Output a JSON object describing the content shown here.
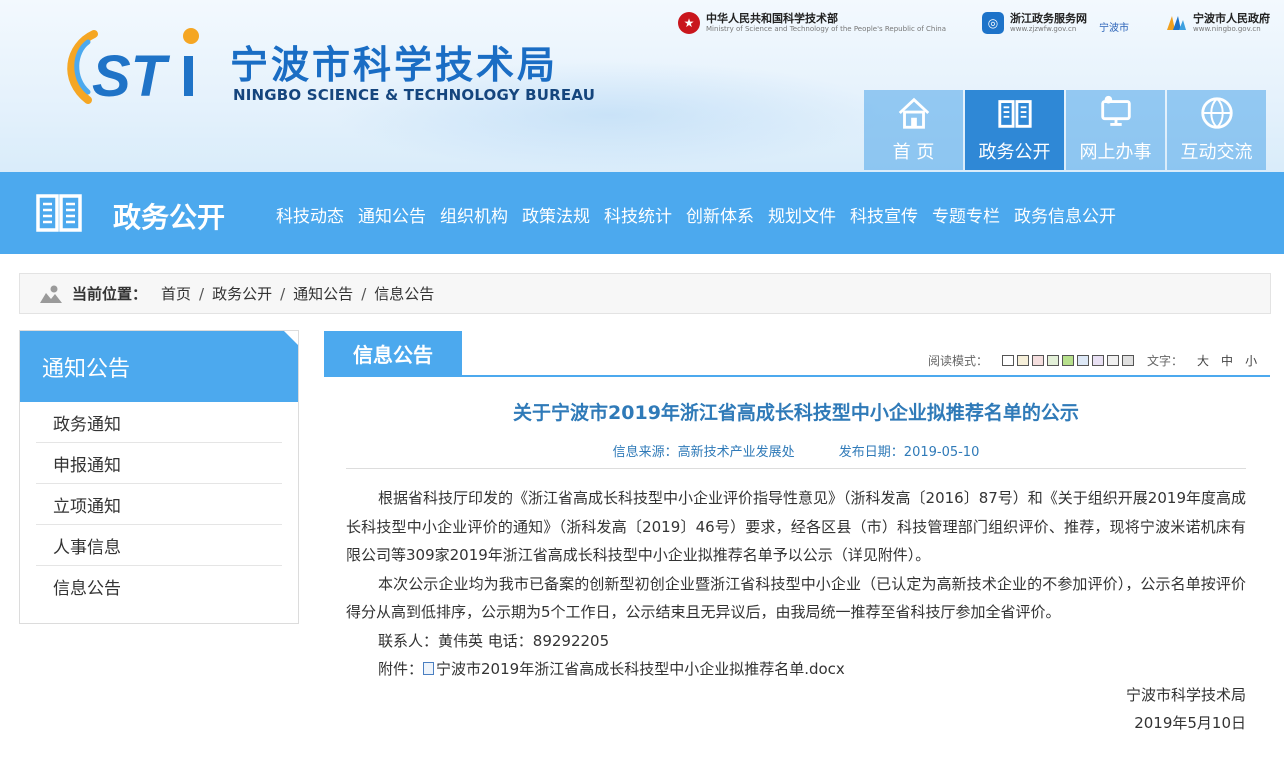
{
  "site": {
    "title": "宁波市科学技术局",
    "subtitle": "NINGBO SCIENCE & TECHNOLOGY BUREAU",
    "logo_text": "STi"
  },
  "top_links": [
    {
      "name": "中华人民共和国科学技术部",
      "sub": "Ministry of Science and Technology of the People's Republic of China",
      "icon": "national-emblem-icon"
    },
    {
      "name": "浙江政务服务网",
      "sub": "www.zjzwfw.gov.cn",
      "extra": "宁波市",
      "icon": "zjzwfw-logo-icon"
    },
    {
      "name": "宁波市人民政府",
      "sub": "www.ningbo.gov.cn",
      "icon": "ningbo-gov-logo-icon"
    }
  ],
  "top_nav": [
    {
      "label": "首 页",
      "icon": "home-icon"
    },
    {
      "label": "政务公开",
      "icon": "book-icon",
      "active": true
    },
    {
      "label": "网上办事",
      "icon": "computer-icon"
    },
    {
      "label": "互动交流",
      "icon": "globe-people-icon"
    }
  ],
  "band": {
    "title": "政务公开",
    "menu": [
      "科技动态",
      "通知公告",
      "组织机构",
      "政策法规",
      "科技统计",
      "创新体系",
      "规划文件",
      "科技宣传",
      "专题专栏",
      "政务信息公开"
    ]
  },
  "breadcrumb": {
    "lead": "当前位置：",
    "items": [
      "首页",
      "政务公开",
      "通知公告",
      "信息公告"
    ],
    "separator": "/"
  },
  "sidebar": {
    "title": "通知公告",
    "items": [
      "政务通知",
      "申报通知",
      "立项通知",
      "人事信息",
      "信息公告"
    ]
  },
  "main": {
    "tab": "信息公告",
    "reading_mode_label": "阅读模式：",
    "reading_mode_colors": [
      "#ffffff",
      "#f6efd9",
      "#f4dede",
      "#e3f0d8",
      "#b7e08c",
      "#dde8f6",
      "#e8e0f3",
      "#f0f0f0",
      "#e0e0e0"
    ],
    "font_size_label": "文字：",
    "font_sizes": [
      "大",
      "中",
      "小"
    ]
  },
  "article": {
    "title": "关于宁波市2019年浙江省高成长科技型中小企业拟推荐名单的公示",
    "source": "信息来源：高新技术产业发展处",
    "date": "发布日期：2019-05-10",
    "paragraphs": [
      "根据省科技厅印发的《浙江省高成长科技型中小企业评价指导性意见》（浙科发高〔2016〕87号）和《关于组织开展2019年度高成长科技型中小企业评价的通知》（浙科发高〔2019〕46号）要求，经各区县（市）科技管理部门组织评价、推荐，现将宁波米诺机床有限公司等309家2019年浙江省高成长科技型中小企业拟推荐名单予以公示（详见附件）。",
      "本次公示企业均为我市已备案的创新型初创企业暨浙江省科技型中小企业（已认定为高新技术企业的不参加评价），公示名单按评价得分从高到低排序，公示期为5个工作日，公示结束且无异议后，由我局统一推荐至省科技厅参加全省评价。",
      "联系人：黄伟英  电话：89292205"
    ],
    "attachment_label": "附件：",
    "attachment_name": "宁波市2019年浙江省高成长科技型中小企业拟推荐名单.docx",
    "signature_org": "宁波市科学技术局",
    "signature_date": "2019年5月10日"
  }
}
